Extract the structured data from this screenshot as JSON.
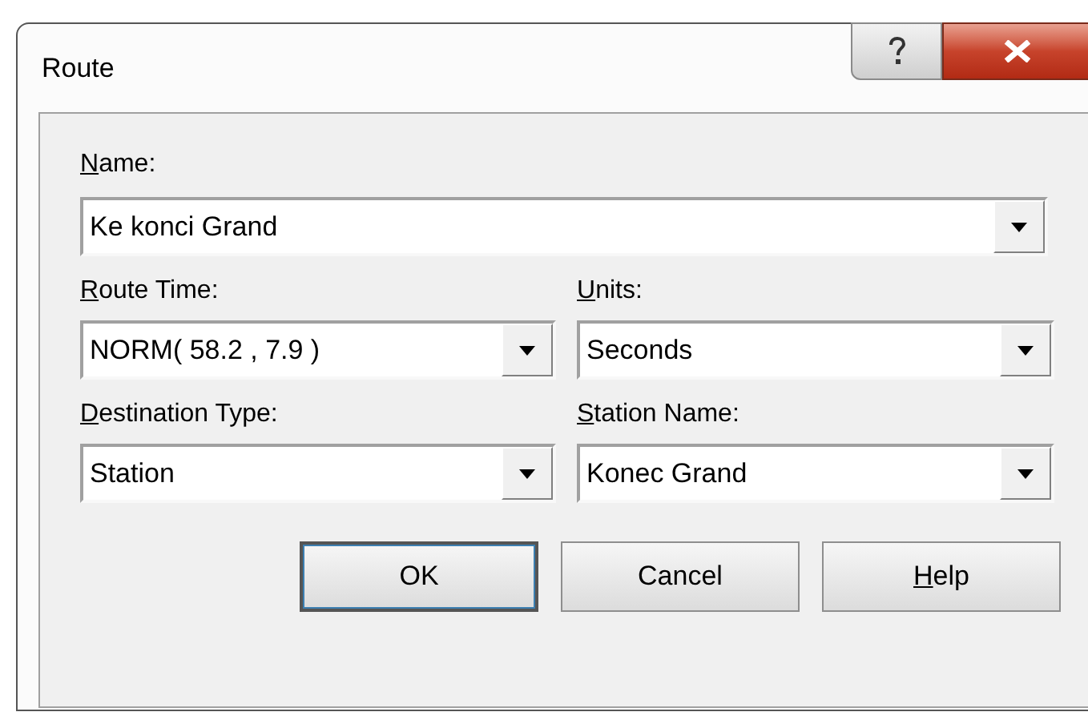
{
  "window": {
    "title": "Route"
  },
  "name_field": {
    "label": "Name:",
    "mnemonic": true,
    "value": "Ke konci Grand"
  },
  "fields": [
    {
      "label": "Route Time:",
      "mnemonic": true,
      "value": "NORM( 58.2 , 7.9 )"
    },
    {
      "label": "Units:",
      "mnemonic": true,
      "value": "Seconds"
    },
    {
      "label": "Destination Type:",
      "mnemonic": true,
      "value": "Station"
    },
    {
      "label": "Station Name:",
      "mnemonic": true,
      "value": "Konec Grand"
    }
  ],
  "buttons": [
    {
      "label": "OK",
      "default": true,
      "mnemonic": false
    },
    {
      "label": "Cancel",
      "default": false,
      "mnemonic": false
    },
    {
      "label": "Help",
      "default": false,
      "mnemonic": true
    }
  ]
}
